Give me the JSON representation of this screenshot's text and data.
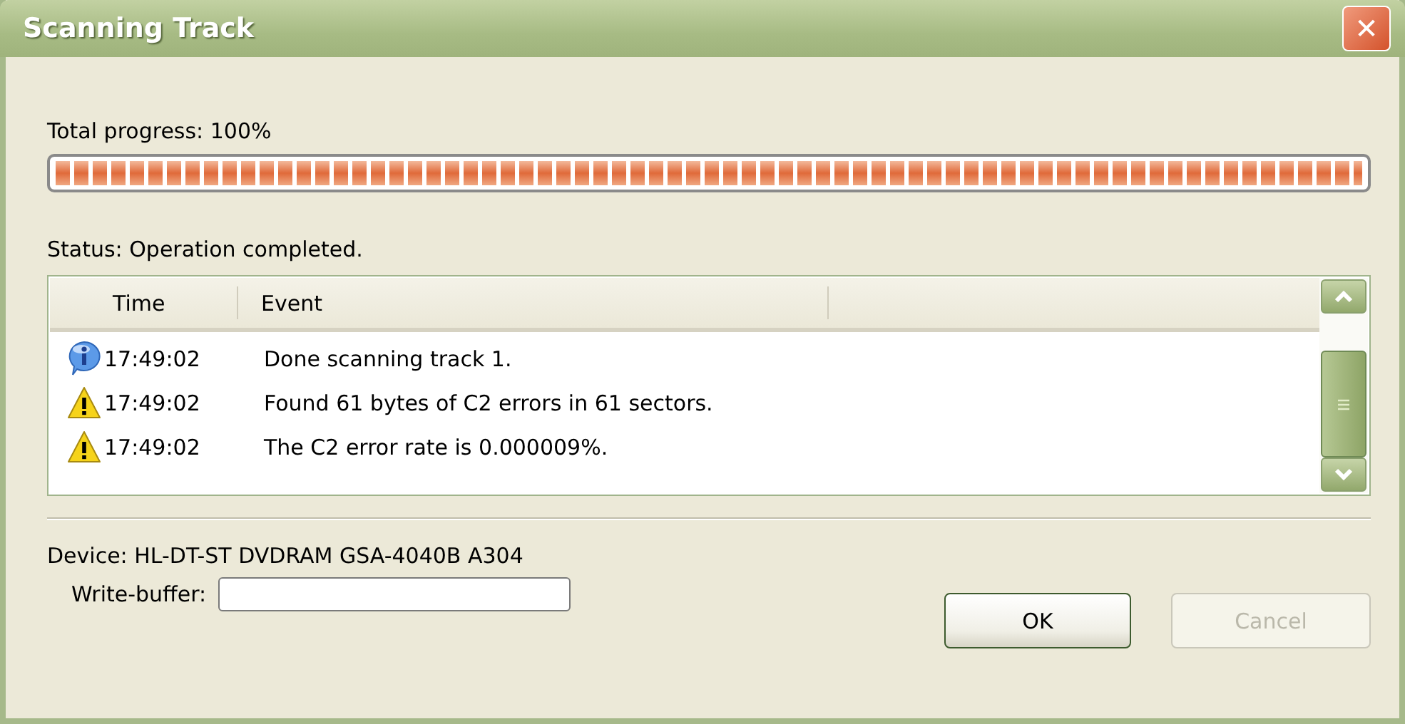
{
  "window": {
    "title": "Scanning Track",
    "close": "✕"
  },
  "progress": {
    "label": "Total progress: 100%",
    "level": 1.0
  },
  "status": "Status: Operation completed.",
  "event_list": {
    "columns": [
      "Time",
      "Event"
    ],
    "rows": [
      {
        "kind": "info",
        "time": "17:49:02",
        "event": "Done scanning track 1."
      },
      {
        "kind": "warning",
        "time": "17:49:02",
        "event": "Found 61 bytes of C2 errors in 61 sectors."
      },
      {
        "kind": "warning",
        "time": "17:49:02",
        "event": "The C2 error rate is 0.000009%."
      }
    ]
  },
  "device": "Device: HL-DT-ST DVDRAM GSA-4040B A304",
  "write_buffer": {
    "label": "Write-buffer:"
  },
  "buttons": [
    {
      "label": "OK",
      "disabled": false
    },
    {
      "label": "Cancel",
      "disabled": true
    }
  ]
}
